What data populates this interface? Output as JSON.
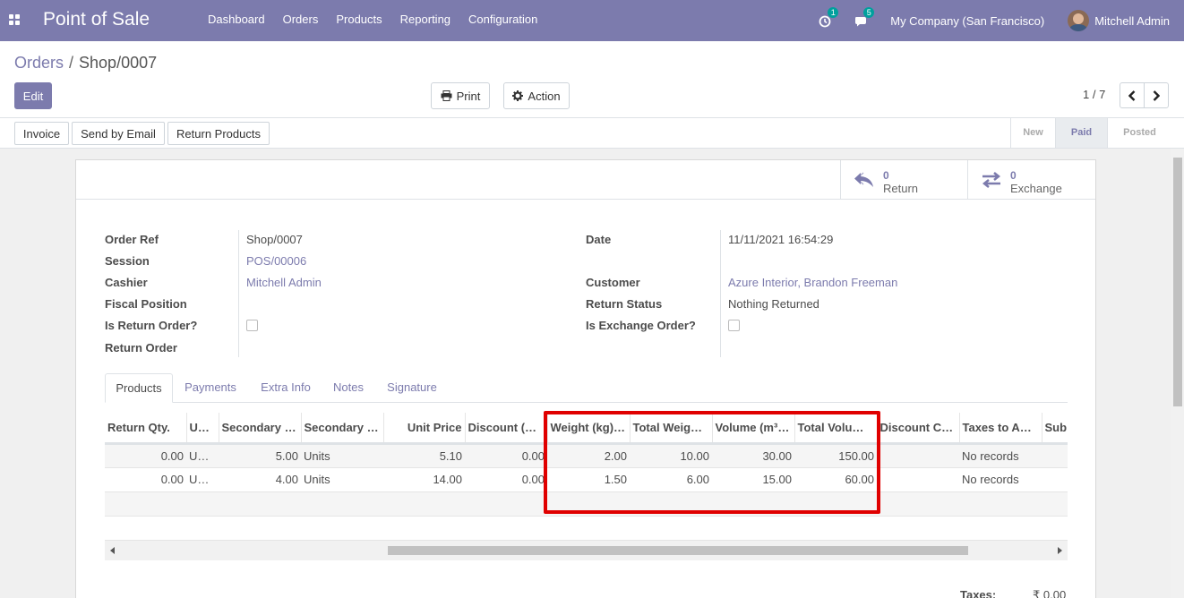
{
  "navbar": {
    "app_title": "Point of Sale",
    "menu": [
      "Dashboard",
      "Orders",
      "Products",
      "Reporting",
      "Configuration"
    ],
    "activity_count": "1",
    "message_count": "5",
    "company": "My Company (San Francisco)",
    "user": "Mitchell Admin",
    "icons": {
      "apps": "apps-grid-icon",
      "activity": "clock-icon",
      "messages": "chat-icon"
    }
  },
  "breadcrumb": {
    "parent": "Orders",
    "separator": "/",
    "current": "Shop/0007"
  },
  "toolbar": {
    "edit_label": "Edit",
    "print_label": "Print",
    "action_label": "Action"
  },
  "pager": {
    "value": "1 / 7"
  },
  "statusbar": {
    "buttons": [
      "Invoice",
      "Send by Email",
      "Return Products"
    ],
    "stages": [
      {
        "label": "New",
        "active": false
      },
      {
        "label": "Paid",
        "active": true
      },
      {
        "label": "Posted",
        "active": false
      }
    ]
  },
  "smart_buttons": [
    {
      "value": "0",
      "label": "Return",
      "icon": "reply-icon"
    },
    {
      "value": "0",
      "label": "Exchange",
      "icon": "exchange-arrows-icon"
    }
  ],
  "form": {
    "left": [
      {
        "label": "Order Ref",
        "value": "Shop/0007",
        "link": false
      },
      {
        "label": "Session",
        "value": "POS/00006",
        "link": true
      },
      {
        "label": "Cashier",
        "value": "Mitchell Admin",
        "link": true
      },
      {
        "label": "Fiscal Position",
        "value": "",
        "link": false
      },
      {
        "label": "Is Return Order?",
        "value": "",
        "checkbox": true,
        "checked": false
      },
      {
        "label": "Return Order",
        "value": "",
        "link": false
      }
    ],
    "right": [
      {
        "label": "Date",
        "value": "11/11/2021 16:54:29",
        "link": false
      },
      {
        "label": "Customer",
        "value": "Azure Interior, Brandon Freeman",
        "link": true
      },
      {
        "label": "Return Status",
        "value": "Nothing Returned",
        "link": false
      },
      {
        "label": "Is Exchange Order?",
        "value": "",
        "checkbox": true,
        "checked": false
      }
    ]
  },
  "tabs": [
    "Products",
    "Payments",
    "Extra Info",
    "Notes",
    "Signature"
  ],
  "lines_table": {
    "columns": [
      "Return Qty.",
      "U…",
      "Secondary …",
      "Secondary …",
      "Unit Price",
      "Discount (…",
      "Weight (kg)…",
      "Total Weig…",
      "Volume (m³…",
      "Total Volu…",
      "Discount C…",
      "Taxes to A…",
      "Sub"
    ],
    "rows": [
      [
        "0.00",
        "U…",
        "5.00",
        "Units",
        "5.10",
        "0.00",
        "2.00",
        "10.00",
        "30.00",
        "150.00",
        "",
        "No records",
        ""
      ],
      [
        "0.00",
        "U…",
        "4.00",
        "Units",
        "14.00",
        "0.00",
        "1.50",
        "6.00",
        "15.00",
        "60.00",
        "",
        "No records",
        ""
      ]
    ]
  },
  "totals": {
    "taxes_label": "Taxes:",
    "taxes_value": "₹ 0.00"
  },
  "colors": {
    "brand": "#7c7bad",
    "highlight": "#e00000",
    "badge": "#00a09d"
  }
}
